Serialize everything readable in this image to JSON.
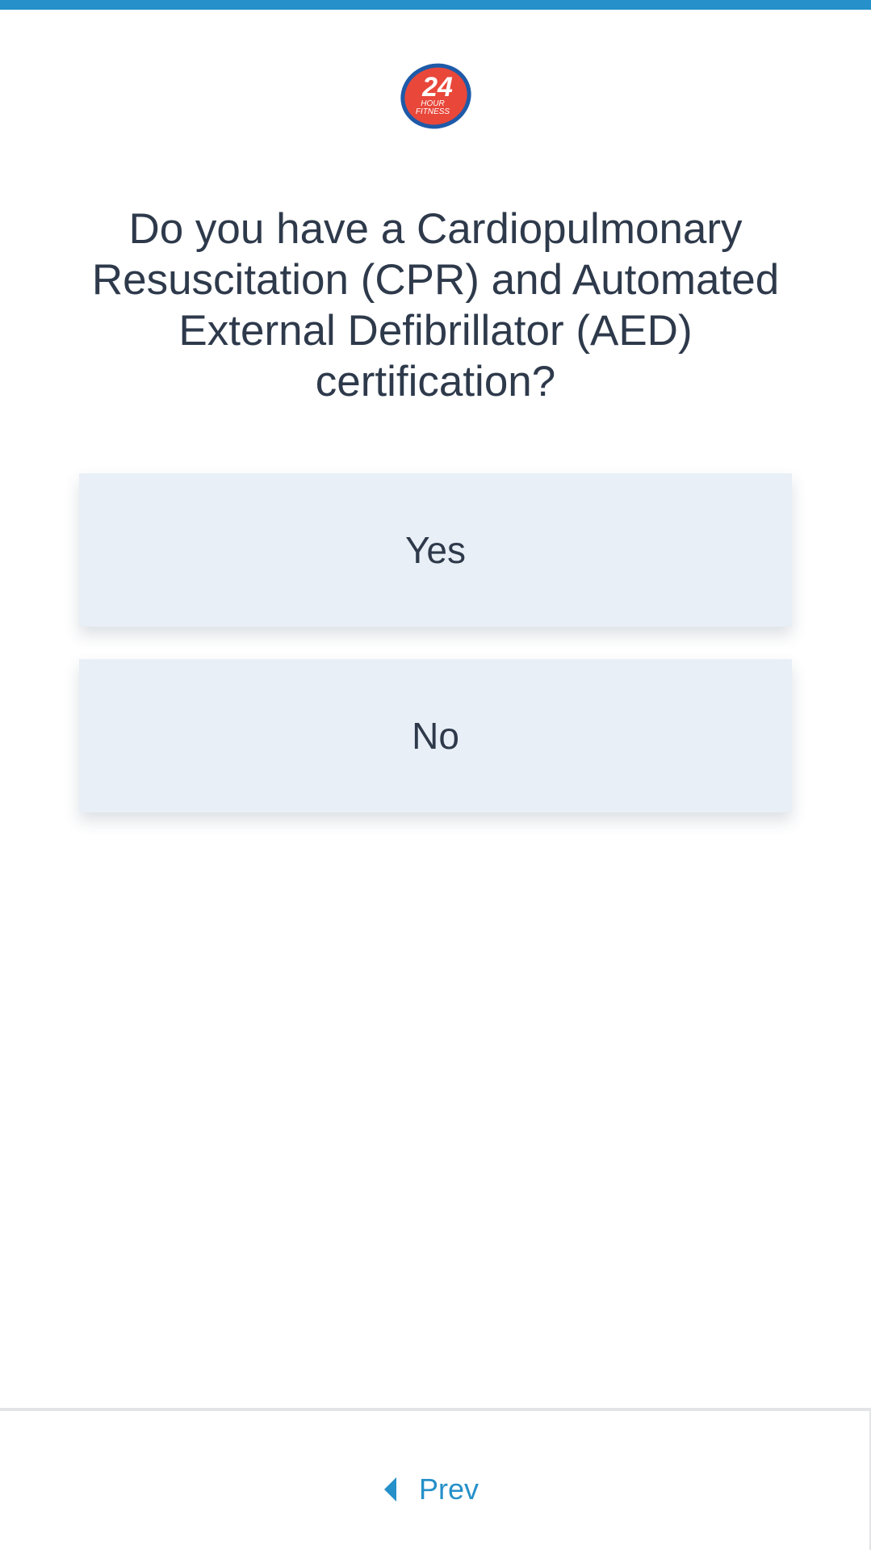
{
  "brand": {
    "logo_number": "24",
    "logo_line1": "HOUR",
    "logo_line2": "FITNESS",
    "colors": {
      "accent": "#2590c9",
      "logo_red": "#e8473a",
      "logo_blue": "#1e5aa8"
    }
  },
  "question": {
    "text": "Do you have a Cardiopulmonary Resuscitation (CPR) and Automated External Defibrillator (AED) certification?"
  },
  "options": [
    {
      "label": "Yes"
    },
    {
      "label": "No"
    }
  ],
  "footer": {
    "prev_label": "Prev",
    "prev_icon": "caret-left-icon"
  }
}
